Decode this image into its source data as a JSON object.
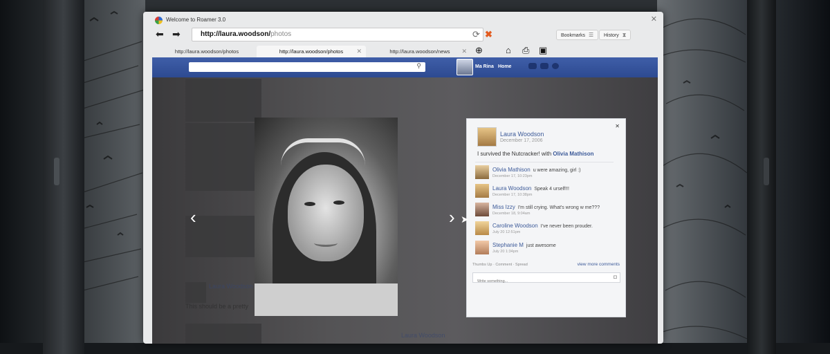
{
  "window": {
    "title": "Welcome to Roamer 3.0",
    "address_host": "http://laura.woodson/",
    "address_path": "photos",
    "bookmarks_label": "Bookmarks",
    "history_label": "History"
  },
  "tabs": [
    {
      "label": "http://laura.woodson/photos"
    },
    {
      "label": "http://laura.woodson/photos"
    },
    {
      "label": "http://laura.woodson/news"
    }
  ],
  "site": {
    "user_name": "Ma Rina",
    "home_label": "Home"
  },
  "post": {
    "author": "Laura Woodson",
    "date": "December 17, 2006",
    "status_text": "I survived the Nutcracker!  with ",
    "tagged": "Olivia Mathison",
    "comments": [
      {
        "name": "Olivia Mathison",
        "text": "u were amazing, girl :)",
        "date": "December 17, 10:23pm"
      },
      {
        "name": "Laura Woodson",
        "text": "Speak 4 urself!!!",
        "date": "December 17, 10:38pm"
      },
      {
        "name": "Miss Izzy",
        "text": "I'm still crying. What's wrong w me???",
        "date": "December 18, 9:04am"
      },
      {
        "name": "Caroline Woodson",
        "text": "I've never been prouder.",
        "date": "July 20 12:51pm"
      },
      {
        "name": "Stephanie M",
        "text": "just awesome",
        "date": "July 20 1:34pm"
      }
    ],
    "actions": "Thumbs Up · Comment · Spread",
    "view_more": "view more comments",
    "write_placeholder": "Write something..."
  },
  "background": {
    "ghost_name": "Laura Woodson",
    "ghost_text": "This should be a pretty",
    "ghost_name_2": "Laura Woodson"
  },
  "colors": {
    "site_blue": "#3b5998",
    "bar_blue": "#2d4a91",
    "stop_orange": "#e25b1f"
  },
  "icons": {
    "back": "arrow-left-icon",
    "forward": "arrow-right-icon",
    "refresh": "refresh-icon",
    "stop": "stop-icon",
    "add_tab": "plus-icon",
    "home": "home-icon",
    "print": "print-icon",
    "save": "save-icon"
  }
}
